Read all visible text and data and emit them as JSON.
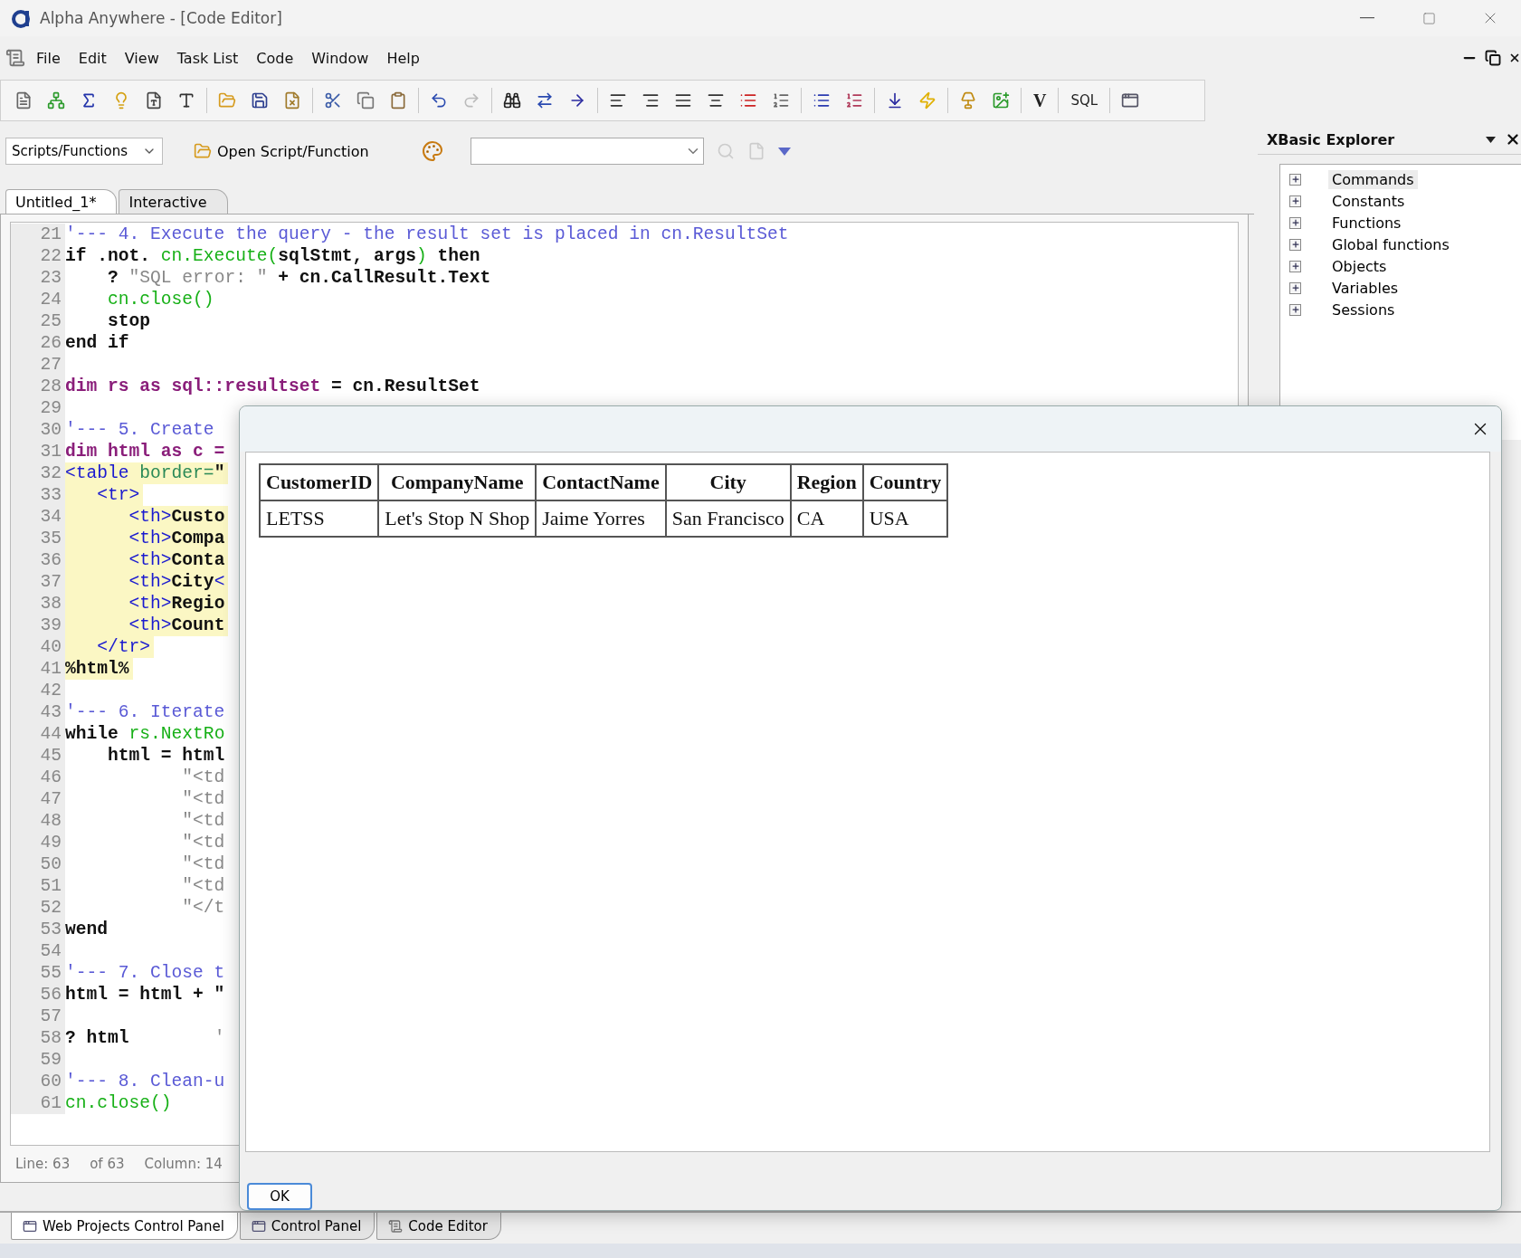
{
  "window": {
    "title": "Alpha Anywhere - [Code Editor]"
  },
  "menu": [
    "File",
    "Edit",
    "View",
    "Task List",
    "Code",
    "Window",
    "Help"
  ],
  "toolbar": {
    "text_buttons": [
      "V",
      "SQL"
    ]
  },
  "script_bar": {
    "dropdown": "Scripts/Functions",
    "open_button": "Open Script/Function"
  },
  "tabs": [
    {
      "label": "Untitled_1*",
      "selected": true
    },
    {
      "label": "Interactive",
      "selected": false
    }
  ],
  "code_lines": [
    {
      "n": "21",
      "highlighted": false,
      "segs": [
        {
          "kind": "comment",
          "text": "'--- 4. Execute the query - the result set is placed in cn.ResultSet"
        }
      ]
    },
    {
      "n": "22",
      "highlighted": false,
      "segs": [
        {
          "kind": "plain",
          "text": "if .not. "
        },
        {
          "kind": "call",
          "text": "cn.Execute("
        },
        {
          "kind": "plain",
          "text": "sqlStmt, args"
        },
        {
          "kind": "call",
          "text": ")"
        },
        {
          "kind": "plain",
          "text": " then"
        }
      ]
    },
    {
      "n": "23",
      "highlighted": false,
      "segs": [
        {
          "kind": "plain",
          "text": "    ? "
        },
        {
          "kind": "string",
          "text": "\"SQL error: \""
        },
        {
          "kind": "plain",
          "text": " + cn.CallResult.Text"
        }
      ]
    },
    {
      "n": "24",
      "highlighted": false,
      "segs": [
        {
          "kind": "call",
          "text": "    cn.close()"
        }
      ]
    },
    {
      "n": "25",
      "highlighted": false,
      "segs": [
        {
          "kind": "plain",
          "text": "    stop"
        }
      ]
    },
    {
      "n": "26",
      "highlighted": false,
      "segs": [
        {
          "kind": "plain",
          "text": "end if"
        }
      ]
    },
    {
      "n": "27"
    },
    {
      "n": "28",
      "highlighted": false,
      "segs": [
        {
          "kind": "keyword",
          "text": "dim rs as sql::resultset"
        },
        {
          "kind": "plain",
          "text": " = cn.ResultSet"
        }
      ]
    },
    {
      "n": "29"
    },
    {
      "n": "30",
      "highlighted": false,
      "segs": [
        {
          "kind": "comment",
          "text": "'--- 5. Create"
        }
      ]
    },
    {
      "n": "31",
      "highlighted": false,
      "segs": [
        {
          "kind": "keyword",
          "text": "dim html as c ="
        }
      ]
    },
    {
      "n": "32",
      "highlighted": true,
      "segs": [
        {
          "kind": "tag",
          "text": "<table "
        },
        {
          "kind": "attr",
          "text": "border="
        },
        {
          "kind": "plain",
          "text": "\""
        }
      ]
    },
    {
      "n": "33",
      "highlighted": true,
      "segs": [
        {
          "kind": "tag",
          "text": "   <tr>"
        }
      ]
    },
    {
      "n": "34",
      "highlighted": true,
      "segs": [
        {
          "kind": "tag",
          "text": "      <th>"
        },
        {
          "kind": "plain",
          "text": "Custo"
        }
      ]
    },
    {
      "n": "35",
      "highlighted": true,
      "segs": [
        {
          "kind": "tag",
          "text": "      <th>"
        },
        {
          "kind": "plain",
          "text": "Compa"
        }
      ]
    },
    {
      "n": "36",
      "highlighted": true,
      "segs": [
        {
          "kind": "tag",
          "text": "      <th>"
        },
        {
          "kind": "plain",
          "text": "Conta"
        }
      ]
    },
    {
      "n": "37",
      "highlighted": true,
      "segs": [
        {
          "kind": "tag",
          "text": "      <th>"
        },
        {
          "kind": "plain",
          "text": "City"
        },
        {
          "kind": "tag",
          "text": "<"
        }
      ]
    },
    {
      "n": "38",
      "highlighted": true,
      "segs": [
        {
          "kind": "tag",
          "text": "      <th>"
        },
        {
          "kind": "plain",
          "text": "Regio"
        }
      ]
    },
    {
      "n": "39",
      "highlighted": true,
      "segs": [
        {
          "kind": "tag",
          "text": "      <th>"
        },
        {
          "kind": "plain",
          "text": "Count"
        }
      ]
    },
    {
      "n": "40",
      "highlighted": true,
      "segs": [
        {
          "kind": "tag",
          "text": "   </tr>"
        }
      ]
    },
    {
      "n": "41",
      "highlighted": true,
      "segs": [
        {
          "kind": "plain",
          "text": "%html%"
        }
      ]
    },
    {
      "n": "42"
    },
    {
      "n": "43",
      "highlighted": false,
      "segs": [
        {
          "kind": "comment",
          "text": "'--- 6. Iterate"
        }
      ]
    },
    {
      "n": "44",
      "highlighted": false,
      "segs": [
        {
          "kind": "plain",
          "text": "while "
        },
        {
          "kind": "call",
          "text": "rs.NextRo"
        }
      ]
    },
    {
      "n": "45",
      "highlighted": false,
      "segs": [
        {
          "kind": "plain",
          "text": "    html = html"
        }
      ]
    },
    {
      "n": "46",
      "highlighted": false,
      "segs": [
        {
          "kind": "string",
          "text": "           \"<td"
        }
      ]
    },
    {
      "n": "47",
      "highlighted": false,
      "segs": [
        {
          "kind": "string",
          "text": "           \"<td"
        }
      ]
    },
    {
      "n": "48",
      "highlighted": false,
      "segs": [
        {
          "kind": "string",
          "text": "           \"<td"
        }
      ]
    },
    {
      "n": "49",
      "highlighted": false,
      "segs": [
        {
          "kind": "string",
          "text": "           \"<td"
        }
      ]
    },
    {
      "n": "50",
      "highlighted": false,
      "segs": [
        {
          "kind": "string",
          "text": "           \"<td"
        }
      ]
    },
    {
      "n": "51",
      "highlighted": false,
      "segs": [
        {
          "kind": "string",
          "text": "           \"<td"
        }
      ]
    },
    {
      "n": "52",
      "highlighted": false,
      "segs": [
        {
          "kind": "string",
          "text": "           \"</t"
        }
      ]
    },
    {
      "n": "53",
      "highlighted": false,
      "segs": [
        {
          "kind": "plain",
          "text": "wend"
        }
      ]
    },
    {
      "n": "54"
    },
    {
      "n": "55",
      "highlighted": false,
      "segs": [
        {
          "kind": "comment",
          "text": "'--- 7. Close t"
        }
      ]
    },
    {
      "n": "56",
      "highlighted": false,
      "segs": [
        {
          "kind": "plain",
          "text": "html = html + \""
        }
      ]
    },
    {
      "n": "57"
    },
    {
      "n": "58",
      "highlighted": false,
      "segs": [
        {
          "kind": "plain",
          "text": "? html        "
        },
        {
          "kind": "string",
          "text": "'"
        }
      ]
    },
    {
      "n": "59"
    },
    {
      "n": "60",
      "highlighted": false,
      "segs": [
        {
          "kind": "comment",
          "text": "'--- 8. Clean-u"
        }
      ]
    },
    {
      "n": "61",
      "highlighted": false,
      "segs": [
        {
          "kind": "call",
          "text": "cn.close()"
        }
      ]
    }
  ],
  "editor_status": [
    "Line: 63",
    "of 63",
    "Column: 14"
  ],
  "explorer": {
    "title": "XBasic Explorer",
    "items": [
      {
        "label": "Commands",
        "selected": true
      },
      {
        "label": "Constants",
        "selected": false
      },
      {
        "label": "Functions",
        "selected": false
      },
      {
        "label": "Global functions",
        "selected": false
      },
      {
        "label": "Objects",
        "selected": false
      },
      {
        "label": "Variables",
        "selected": false
      },
      {
        "label": "Sessions",
        "selected": false
      }
    ]
  },
  "dialog": {
    "table": {
      "columns": [
        "CustomerID",
        "CompanyName",
        "ContactName",
        "City",
        "Region",
        "Country"
      ],
      "rows": [
        [
          "LETSS",
          "Let's Stop N Shop",
          "Jaime Yorres",
          "San Francisco",
          "CA",
          "USA"
        ]
      ]
    },
    "ok_button": "OK"
  },
  "bottom_tabs": [
    {
      "label": "Web Projects Control Panel",
      "selected": true
    },
    {
      "label": "Control Panel",
      "selected": false
    },
    {
      "label": "Code Editor",
      "selected": false
    }
  ]
}
